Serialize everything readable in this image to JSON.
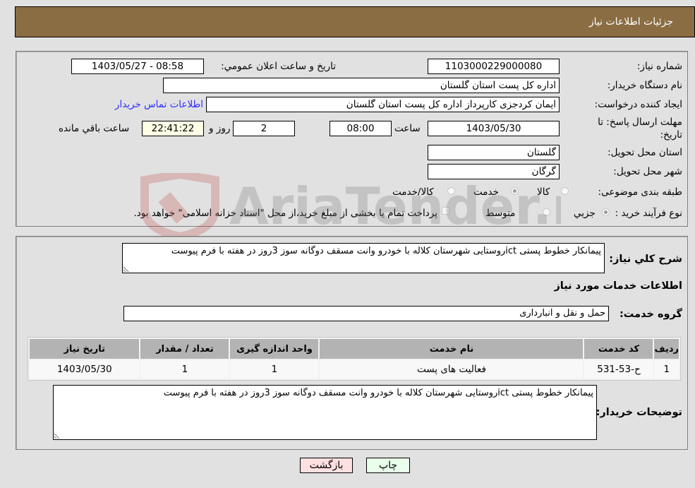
{
  "header": {
    "title": "جزئيات اطلاعات نياز"
  },
  "fields": {
    "need_number": {
      "label": "شماره نياز:",
      "value": "1103000229000080"
    },
    "announce_datetime": {
      "label": "تاريخ و ساعت اعلان عمومي:",
      "value": "1403/05/27 - 08:58"
    },
    "buyer_org": {
      "label": "نام دستگاه خريدار:",
      "value": "اداره کل پست استان گلستان"
    },
    "requester": {
      "label": "ايجاد کننده درخواست:",
      "value": "ايمان کردجزی کارپرداز اداره کل پست استان گلستان"
    },
    "buyer_contact_link": "اطلاعات تماس خريدار",
    "deadline": {
      "label_line1": "مهلت ارسال پاسخ: تا",
      "label_line2": "تاريخ:",
      "date": "1403/05/30",
      "time_label": "ساعت",
      "time": "08:00",
      "days": "2",
      "days_label": "روز و",
      "remaining": "22:41:22",
      "remaining_label": "ساعت باقي مانده"
    },
    "delivery_province": {
      "label": "استان محل تحويل:",
      "value": "گلستان"
    },
    "delivery_city": {
      "label": "شهر محل تحويل:",
      "value": "گرگان"
    },
    "category": {
      "label": "طبقه بندی موضوعی:",
      "options": [
        "کالا",
        "خدمت",
        "کالا/خدمت"
      ],
      "selected": "خدمت"
    },
    "purchase_type": {
      "label": "نوع فرآيند خريد :",
      "options": [
        "جزيي",
        "متوسط"
      ],
      "selected": "جزيي",
      "treasury_note": "پرداخت تمام يا بخشی از مبلغ خريد،از محل \"اسناد خزانه اسلامی\" خواهد بود."
    }
  },
  "summary": {
    "label": "شرح کلي نياز:",
    "value": "پيمانکار خطوط پستی ictروستايی شهرستان کلاله با خودرو وانت مسقف دوگانه سوز 3روز در هفته با فرم پيوست"
  },
  "services": {
    "section_title": "اطلاعات خدمات مورد نياز",
    "group_label": "گروه خدمت:",
    "group_value": "حمل و نقل و انبارداری",
    "table": {
      "columns": [
        "رديف",
        "کد خدمت",
        "نام خدمت",
        "واحد اندازه گيری",
        "تعداد / مقدار",
        "تاريخ نياز"
      ],
      "rows": [
        [
          "1",
          "ح-53-531",
          "فعاليت های پست",
          "1",
          "1",
          "1403/05/30"
        ]
      ]
    }
  },
  "buyer_notes": {
    "label": "توضيحات خريدار:",
    "value": "پيمانکار خطوط پستی ictروستايی شهرستان کلاله با خودرو وانت مسقف دوگانه سوز 3روز در هفته با فرم پيوست"
  },
  "buttons": {
    "print": "چاپ",
    "back": "بازگشت"
  },
  "watermark": {
    "text": "AriaTender.neT"
  }
}
